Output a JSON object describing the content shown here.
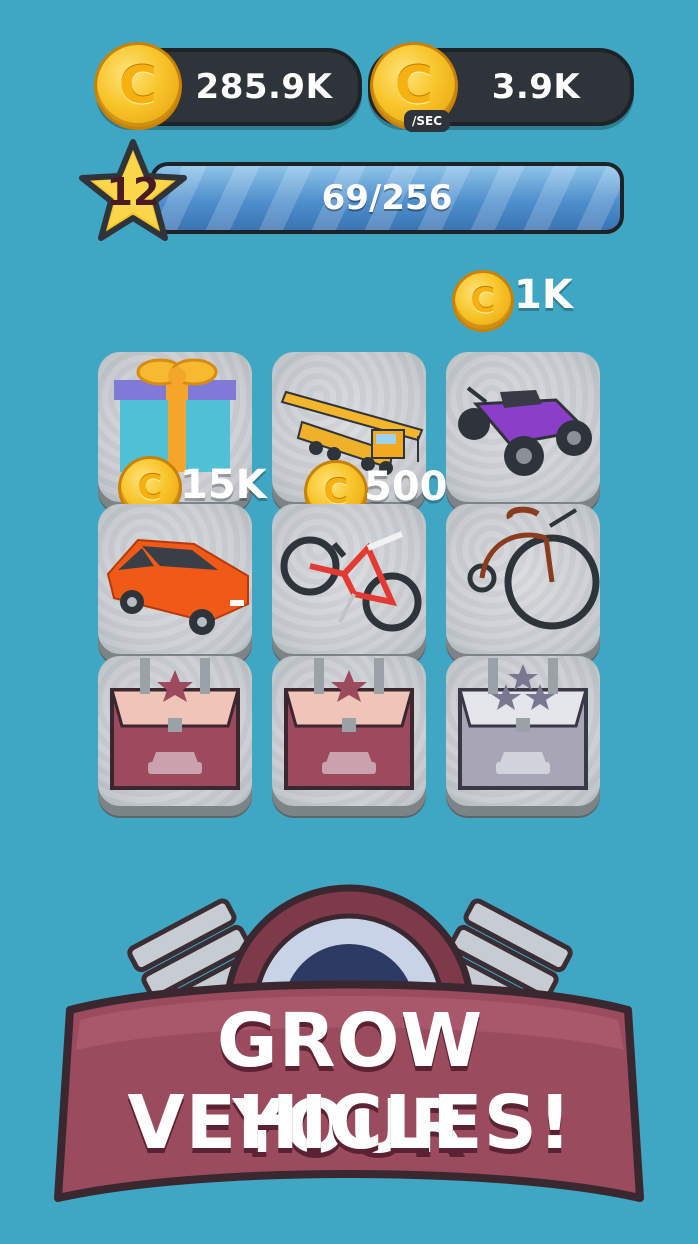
{
  "currency": {
    "coins": "285.9K",
    "income": "3.9K",
    "income_unit": "/SEC",
    "coin_symbol": "C"
  },
  "level": {
    "number": "12",
    "progress_text": "69/256",
    "progress_fraction": 0.27
  },
  "buy_prices": {
    "top": "1K",
    "car": "15K",
    "bike": "500"
  },
  "grid": {
    "rows": [
      [
        "gift-box",
        "crane-truck",
        "quad-bike"
      ],
      [
        "car",
        "mountain-bike",
        "penny-farthing"
      ],
      [
        "crate",
        "crate",
        "crate-silver"
      ]
    ]
  },
  "banner": {
    "line1": "GROW YOUR",
    "line2": "VEHICLES!"
  },
  "colors": {
    "background": "#3fa6c4",
    "pill": "#2f343b",
    "coin": "#f8c52a",
    "star": "#f7c325",
    "banner": "#9a4b5d"
  }
}
